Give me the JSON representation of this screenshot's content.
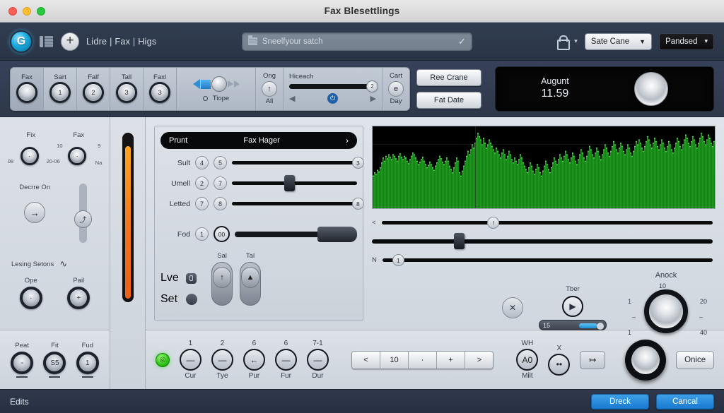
{
  "window": {
    "title": "Fax Blesettlings"
  },
  "toolbar": {
    "logo_letter": "G",
    "breadcrumbs": "Lidre | Fax | Higs",
    "search": {
      "placeholder": "Sneelfyour satch",
      "check": "✓"
    },
    "lock_caret": "▾",
    "dropdown_1": {
      "label": "Sate Cane",
      "arrow": "▼"
    },
    "dropdown_2": {
      "label": "Pandsed",
      "arrow": "▾"
    }
  },
  "knobstrip": {
    "cells": [
      {
        "label": "Fax",
        "value": ""
      },
      {
        "label": "Sart",
        "value": "1"
      },
      {
        "label": "Falf",
        "value": "2"
      },
      {
        "label": "Tall",
        "value": "3"
      },
      {
        "label": "Faxl",
        "value": "3"
      }
    ],
    "tiope_label": "Tiope",
    "ong": {
      "top": "Ong",
      "glyph": "↑",
      "bottom": "All"
    },
    "hiceach": {
      "label": "Hiceach",
      "value": "2",
      "left_arrow": "◀",
      "right_arrow": "▶",
      "power": "⏻"
    },
    "cart": {
      "top": "Cart",
      "value": "e",
      "bottom": "Day"
    },
    "buttons": [
      "Ree Crane",
      "Fat Date"
    ],
    "display": {
      "line1": "Augunt",
      "line2": "11.59"
    }
  },
  "left_panel": {
    "knob_fix": {
      "label": "Fix",
      "min": "08",
      "max": "20-06"
    },
    "knob_fax": {
      "label": "Fax",
      "s1": "10",
      "s2": "9",
      "s3": "Na"
    },
    "decrre": {
      "label": "Decrre On",
      "glyph": "→"
    },
    "vslider_glyph": "⤴",
    "lesing": {
      "label": "Lesing Setons",
      "wave": "∿"
    },
    "ope": {
      "label": "Ope",
      "value": "·"
    },
    "pail": {
      "label": "Pail",
      "value": "+"
    },
    "bottom_knobs": [
      {
        "label": "Peat",
        "value": "-"
      },
      {
        "label": "Fit",
        "value": "S5"
      },
      {
        "label": "Fud",
        "value": "1"
      }
    ]
  },
  "control_panel": {
    "header": {
      "left": "Prunt",
      "center": "Fax Hager",
      "chevron": "›"
    },
    "rows": [
      {
        "label": "Sult",
        "p1": "4",
        "p2": "5",
        "thumb": "3",
        "pos": 96
      },
      {
        "label": "Umell",
        "p1": "2",
        "p2": "7",
        "thumb": "",
        "pos": 42
      },
      {
        "label": "Letted",
        "p1": "7",
        "p2": "8",
        "thumb": "8",
        "pos": 96
      }
    ],
    "fod": {
      "label": "Fod",
      "p1": "1",
      "ring": "00"
    },
    "lve": {
      "label": "Lve"
    },
    "set": {
      "label": "Set"
    },
    "sal": {
      "label": "Sal",
      "glyph": "↑"
    },
    "tal": {
      "label": "Tal",
      "glyph": "▲"
    },
    "slider_a": {
      "prefix": "<",
      "thumb": "!",
      "pos": 32
    },
    "slider_b": {
      "pos": 24
    },
    "slider_c": {
      "prefix": "N",
      "thumb": "1",
      "pos": 3
    }
  },
  "right_controls": {
    "close": {
      "glyph": "✕"
    },
    "tber": {
      "label": "Tber",
      "glyph": "▶"
    },
    "progress": {
      "value": "15"
    },
    "anock": {
      "title": "Anock",
      "s1": "1",
      "s2": "10",
      "s3": "20",
      "s4": "1",
      "s5": "40",
      "tick_l": "–",
      "tick_r": "–"
    }
  },
  "bottom_strip": {
    "led": "◎",
    "buttons": [
      {
        "num": "1",
        "glyph": "—",
        "caption": "Cur"
      },
      {
        "num": "2",
        "glyph": "—",
        "caption": "Tye"
      },
      {
        "num": "6",
        "glyph": "←",
        "caption": "Pur"
      },
      {
        "num": "6",
        "glyph": "—",
        "caption": "Fur"
      },
      {
        "num": "7-1",
        "glyph": "—",
        "caption": "Dur"
      }
    ],
    "segments": [
      "<",
      "10",
      "·",
      "+",
      ">"
    ],
    "wh": {
      "top": "WH",
      "value": "A0",
      "bottom": "Milt"
    },
    "x_btn": {
      "top": "X",
      "glyph": "••"
    },
    "swap_btn": {
      "glyph": "↦"
    },
    "onice": "Onice"
  },
  "footer": {
    "status": "Edits",
    "primary": "Dreck",
    "secondary": "Cancal"
  },
  "waveform": {
    "color": "#14a314",
    "line_color": "#55e855",
    "background": "#000000",
    "playhead_pct": 30,
    "values": [
      40,
      44,
      42,
      47,
      45,
      50,
      56,
      62,
      58,
      64,
      61,
      66,
      63,
      60,
      66,
      64,
      61,
      58,
      64,
      67,
      63,
      60,
      64,
      62,
      58,
      55,
      60,
      64,
      68,
      66,
      62,
      58,
      54,
      57,
      60,
      63,
      58,
      54,
      50,
      53,
      57,
      54,
      50,
      47,
      52,
      56,
      60,
      64,
      61,
      57,
      54,
      58,
      62,
      58,
      52,
      48,
      44,
      50,
      56,
      62,
      58,
      44,
      40,
      46,
      52,
      58,
      64,
      70,
      66,
      72,
      78,
      74,
      80,
      86,
      92,
      88,
      84,
      78,
      86,
      80,
      74,
      78,
      84,
      80,
      76,
      72,
      68,
      74,
      70,
      66,
      62,
      68,
      72,
      66,
      60,
      64,
      70,
      66,
      60,
      56,
      62,
      58,
      54,
      60,
      66,
      62,
      56,
      52,
      48,
      44,
      50,
      56,
      52,
      46,
      42,
      48,
      54,
      50,
      44,
      40,
      46,
      52,
      58,
      54,
      48,
      44,
      50,
      56,
      62,
      58,
      54,
      60,
      66,
      62,
      58,
      64,
      70,
      66,
      60,
      56,
      62,
      68,
      64,
      58,
      54,
      60,
      66,
      72,
      68,
      62,
      58,
      64,
      70,
      76,
      72,
      66,
      62,
      68,
      74,
      70,
      64,
      60,
      66,
      72,
      78,
      74,
      68,
      64,
      70,
      76,
      82,
      78,
      72,
      68,
      74,
      80,
      76,
      70,
      66,
      72,
      78,
      74,
      68,
      64,
      70,
      76,
      82,
      78,
      84,
      80,
      74,
      70,
      76,
      82,
      88,
      84,
      78,
      74,
      80,
      86,
      82,
      76,
      72,
      78,
      84,
      80,
      74,
      70,
      76,
      82,
      78,
      72,
      68,
      74,
      80,
      86,
      82,
      76,
      72,
      78,
      84,
      90,
      86,
      80,
      76,
      82,
      88,
      84,
      78,
      74,
      80,
      86,
      92,
      88,
      82,
      78,
      84,
      90,
      86,
      80,
      76,
      82
    ]
  }
}
